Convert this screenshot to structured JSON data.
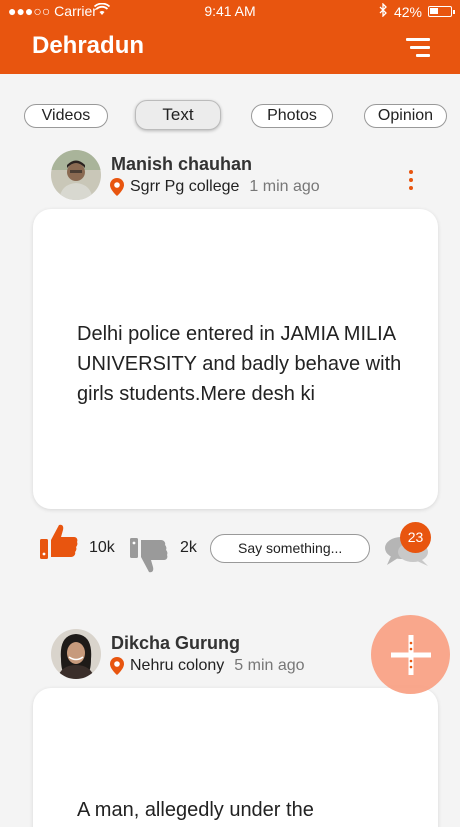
{
  "status_bar": {
    "carrier": "●●●○○ Carrier",
    "time": "9:41 AM",
    "battery": "42%"
  },
  "header": {
    "title": "Dehradun"
  },
  "tabs": [
    {
      "label": "Videos"
    },
    {
      "label": "Text"
    },
    {
      "label": "Photos"
    },
    {
      "label": "Opinion"
    }
  ],
  "posts": [
    {
      "author": "Manish chauhan",
      "location": "Sgrr Pg college",
      "time": "1 min ago",
      "body": "Delhi police entered in JAMIA MILIA UNIVERSITY and badly behave with girls students.Mere desh ki",
      "likes": "10k",
      "dislikes": "2k",
      "comment_placeholder": "Say something...",
      "comment_count": "23"
    },
    {
      "author": "Dikcha Gurung",
      "location": "Nehru colony",
      "time": "5 min ago",
      "body": "A man, allegedly under the"
    }
  ],
  "colors": {
    "accent": "#e8550f",
    "fab": "#f8a082"
  }
}
